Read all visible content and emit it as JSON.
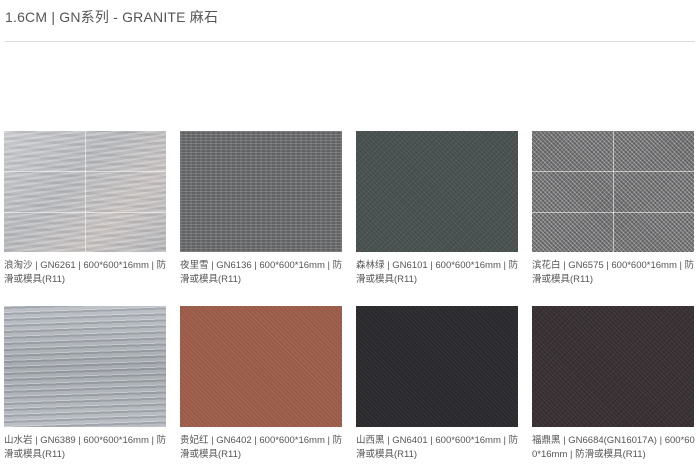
{
  "page": {
    "title": "1.6CM | GN系列 - GRANITE 麻石"
  },
  "products": [
    {
      "caption": "浪淘沙 | GN6261 | 600*600*16mm | 防滑或模具(R11)",
      "image": "light-grey-granite-tile"
    },
    {
      "caption": "夜里雪 | GN6136 | 600*600*16mm | 防滑或模具(R11)",
      "image": "grey-granite-tile"
    },
    {
      "caption": "森林绿 | GN6101 | 600*600*16mm | 防滑或模具(R11)",
      "image": "dark-green-granite-tile"
    },
    {
      "caption": "滨花白 | GN6575 | 600*600*16mm | 防滑或模具(R11)",
      "image": "speckled-grey-granite-tile"
    },
    {
      "caption": "山水岩 | GN6389 | 600*600*16mm | 防滑或模具(R11)",
      "image": "streaked-grey-granite-tile"
    },
    {
      "caption": "贵妃红 | GN6402 | 600*600*16mm | 防滑或模具(R11)",
      "image": "red-granite-tile"
    },
    {
      "caption": "山西黑 | GN6401 | 600*600*16mm | 防滑或模具(R11)",
      "image": "black-granite-tile"
    },
    {
      "caption": "福鼎黑 | GN6684(GN16017A) | 600*600*16mm | 防滑或模具(R11)",
      "image": "dark-brown-black-granite-tile"
    }
  ],
  "colors": {
    "title": "#555555",
    "caption": "#555555",
    "rule": "#dcdcdc"
  }
}
